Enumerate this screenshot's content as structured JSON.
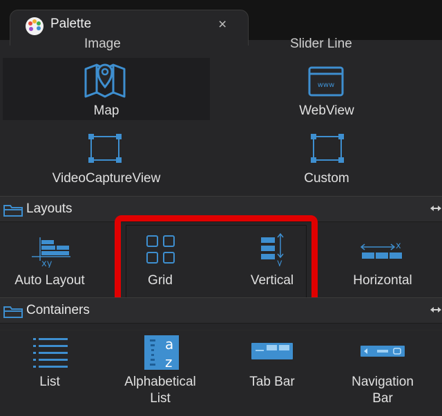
{
  "tab": {
    "title": "Palette",
    "close_glyph": "×"
  },
  "partial_labels": {
    "left": "Image",
    "right": "Slider Line"
  },
  "controls": [
    {
      "label": "Map",
      "icon": "map-icon"
    },
    {
      "label": "WebView",
      "icon": "webview-icon"
    },
    {
      "label": "VideoCaptureView",
      "icon": "videocapture-icon"
    },
    {
      "label": "Custom",
      "icon": "custom-view-icon"
    }
  ],
  "layouts": {
    "header": "Layouts",
    "items": [
      {
        "label": "Auto Layout",
        "icon": "auto-layout-icon",
        "icon_text": "xy"
      },
      {
        "label": "Grid",
        "icon": "grid-icon"
      },
      {
        "label": "Vertical",
        "icon": "vertical-layout-icon",
        "icon_text": "y"
      },
      {
        "label": "Horizontal",
        "icon": "horizontal-layout-icon",
        "icon_text": "x"
      }
    ]
  },
  "containers": {
    "header": "Containers",
    "items": [
      {
        "label": "List",
        "icon": "list-icon"
      },
      {
        "label_line1": "Alphabetical",
        "label_line2": "List",
        "icon": "alphabetical-list-icon",
        "icon_text_top": "a",
        "icon_text_bottom": "z"
      },
      {
        "label": "Tab Bar",
        "icon": "tab-bar-icon"
      },
      {
        "label_line1": "Navigation",
        "label_line2": "Bar",
        "icon": "navigation-bar-icon"
      }
    ]
  },
  "colors": {
    "accent_icon": "#3e8fd0",
    "highlight": "#e00000",
    "background": "#262628"
  }
}
